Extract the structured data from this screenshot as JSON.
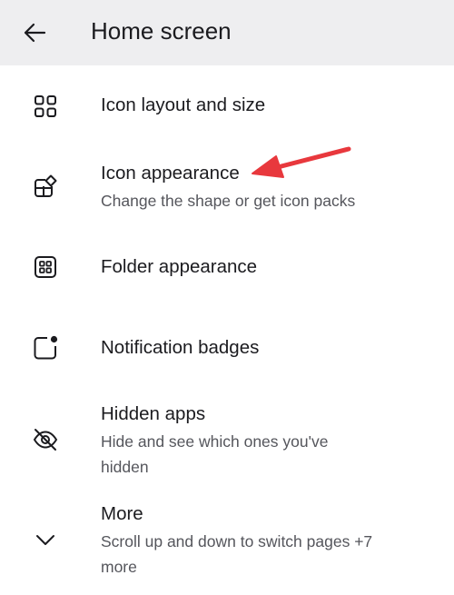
{
  "header": {
    "title": "Home screen",
    "back_icon": "arrow-left-icon"
  },
  "items": [
    {
      "label": "Icon layout and size",
      "icon": "grid-layout-icon"
    },
    {
      "label": "Icon appearance",
      "subtitle": "Change the shape or get icon packs",
      "icon": "icon-shapes-icon"
    },
    {
      "label": "Folder appearance",
      "icon": "folder-grid-icon"
    },
    {
      "label": "Notification badges",
      "icon": "notification-badge-icon"
    },
    {
      "label": "Hidden apps",
      "subtitle": "Hide and see which ones you've hidden",
      "icon": "eye-off-icon"
    },
    {
      "label": "More",
      "subtitle": "Scroll up and down to switch pages +7 more",
      "icon": "chevron-down-icon"
    }
  ],
  "annotation": {
    "color": "#e8383d",
    "icon": "red-arrow-pointer"
  },
  "colors": {
    "header_bg": "#eeeef0",
    "text": "#1b1b1f",
    "subtext": "#55565c"
  }
}
